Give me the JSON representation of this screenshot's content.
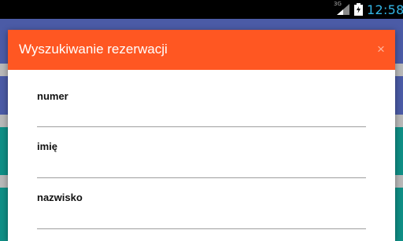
{
  "status_bar": {
    "network": "3G",
    "time": "12:58"
  },
  "dialog": {
    "title": "Wyszukiwanie rezerwacji",
    "close_label": "×",
    "fields": [
      {
        "label": "numer",
        "value": ""
      },
      {
        "label": "imię",
        "value": ""
      },
      {
        "label": "nazwisko",
        "value": ""
      }
    ]
  },
  "colors": {
    "header": "#ff5722",
    "background_blue": "#4b5ba6",
    "background_teal": "#0f8f86",
    "status_accent": "#33b5e5"
  },
  "icons": [
    "signal-icon",
    "battery-charging-icon",
    "close-icon"
  ]
}
